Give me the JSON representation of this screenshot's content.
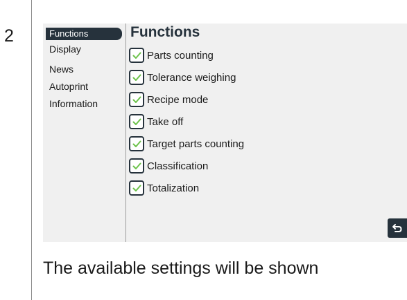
{
  "step": {
    "number": "2"
  },
  "menu": {
    "items": [
      {
        "label": "Functions",
        "active": true
      },
      {
        "label": "Display",
        "active": false
      },
      {
        "label": "News",
        "active": false
      },
      {
        "label": "Autoprint",
        "active": false
      },
      {
        "label": "Information",
        "active": false
      }
    ]
  },
  "content": {
    "title": "Functions",
    "functions": [
      {
        "label": "Parts counting",
        "checked": true
      },
      {
        "label": "Tolerance weighing",
        "checked": true
      },
      {
        "label": "Recipe mode",
        "checked": true
      },
      {
        "label": "Take off",
        "checked": true
      },
      {
        "label": "Target parts counting",
        "checked": true
      },
      {
        "label": "Classification",
        "checked": true
      },
      {
        "label": "Totalization",
        "checked": true
      }
    ]
  },
  "back_button": {
    "icon": "back-arrow-icon"
  },
  "caption": "The available settings will be shown",
  "colors": {
    "accent": "#26323c",
    "check": "#6cc24a",
    "screen_bg": "#f0f0f0"
  }
}
